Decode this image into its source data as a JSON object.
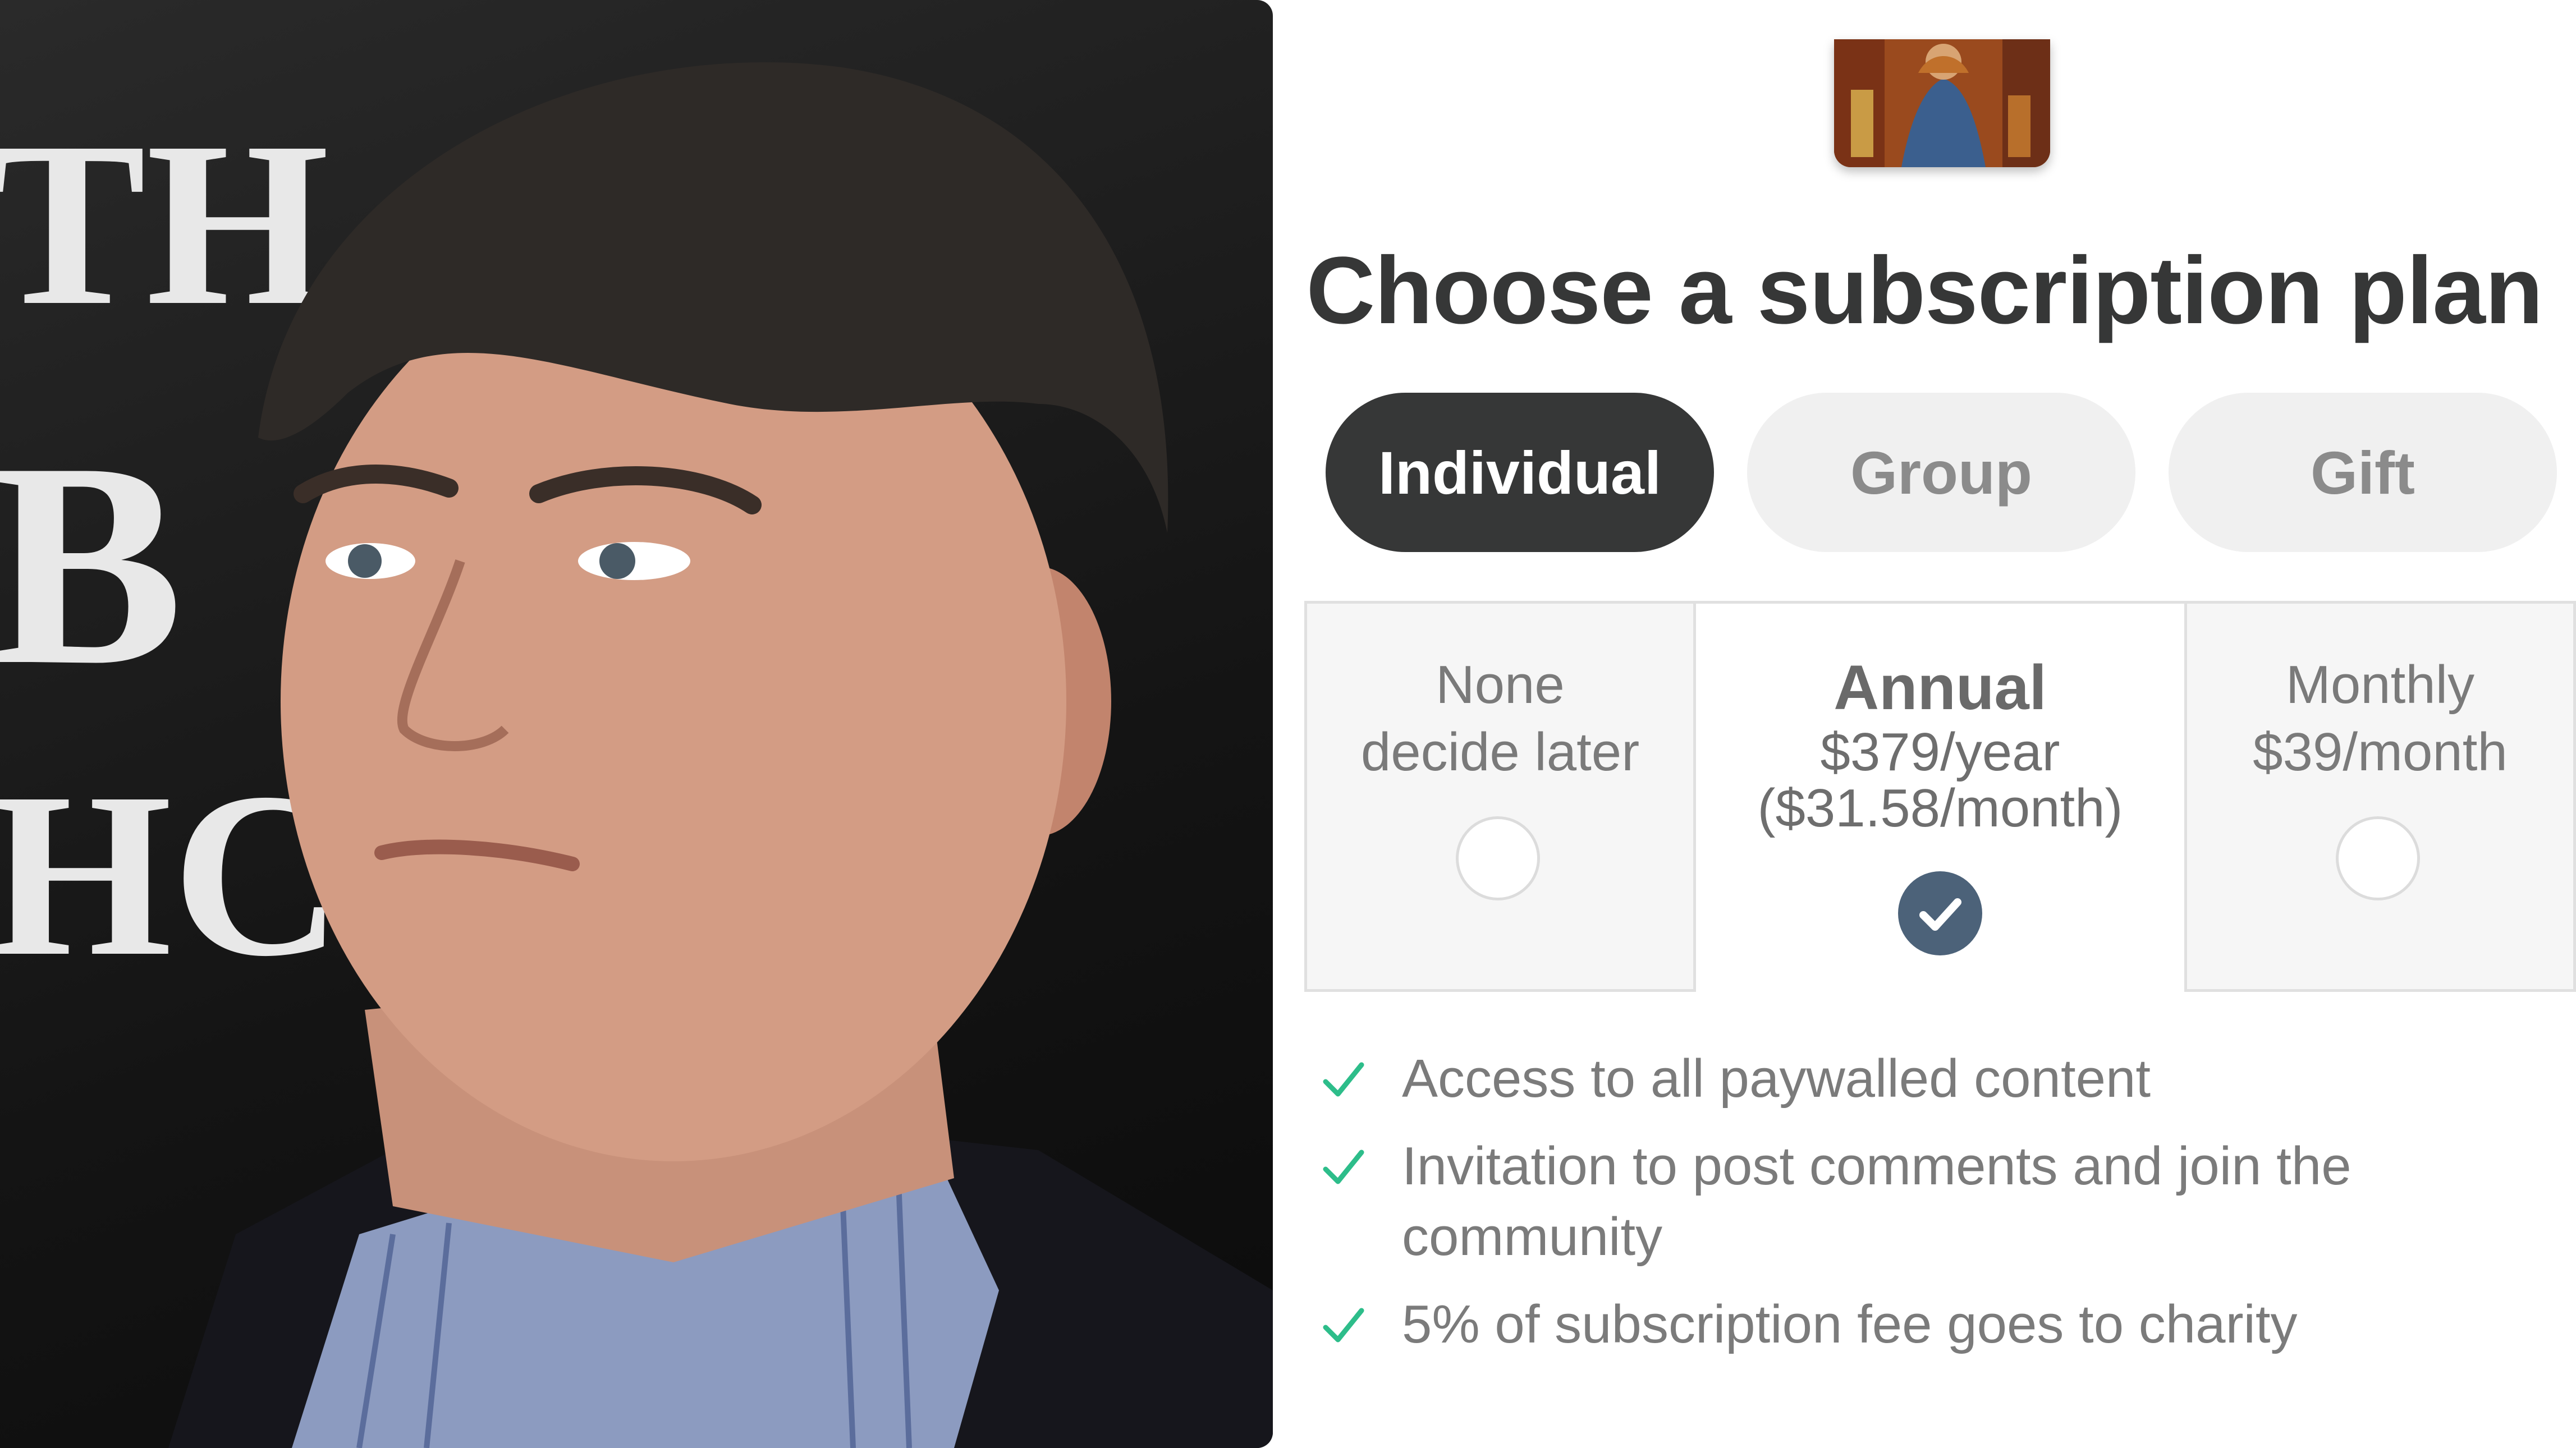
{
  "photo": {
    "alt_text": "Portrait photograph of a man in front of a dark backdrop"
  },
  "backdrop_letters": [
    "TH",
    "B",
    "HC"
  ],
  "publication_logo": {
    "icon": "painting-thumbnail-icon"
  },
  "title": "Choose a subscription plan",
  "subscription_types": [
    {
      "label": "Individual",
      "selected": true
    },
    {
      "label": "Group",
      "selected": false
    },
    {
      "label": "Gift",
      "selected": false
    }
  ],
  "plans": {
    "none": {
      "line1": "None",
      "line2": "decide later",
      "selected": false
    },
    "annual": {
      "name": "Annual",
      "price": "$379/year",
      "per_month": "($31.58/month)",
      "selected": true
    },
    "monthly": {
      "name": "Monthly",
      "price": "$39/month",
      "selected": false
    }
  },
  "features": [
    "Access to all paywalled content",
    "Invitation to post comments and join the community",
    "5% of subscription fee goes to charity"
  ],
  "colors": {
    "selected_tab": "#363737",
    "selected_radio": "#4c6279",
    "feature_check": "#2dbd8a"
  }
}
